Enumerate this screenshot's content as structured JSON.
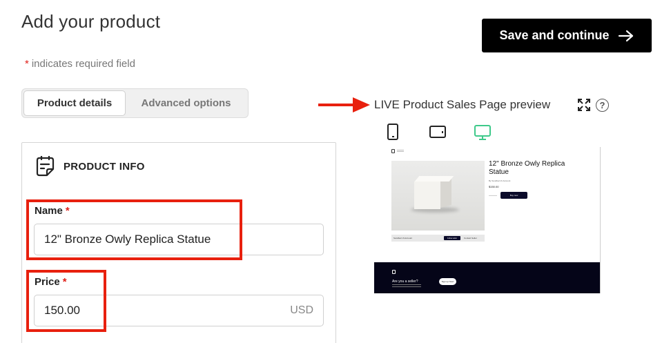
{
  "header": {
    "title": "Add your product",
    "required_star": "*",
    "required_note": "indicates required field",
    "save_label": "Save and continue"
  },
  "tabs": [
    {
      "label": "Product details",
      "active": true
    },
    {
      "label": "Advanced options",
      "active": false
    }
  ],
  "preview": {
    "label": "LIVE Product Sales Page preview",
    "help_glyph": "?",
    "devices": [
      "phone-icon",
      "tablet-icon",
      "desktop-icon"
    ],
    "active_device": "desktop",
    "page": {
      "product_title": "12\" Bronze Owly Replica Statue",
      "by_line": "By Sundbert.th Account",
      "price": "$150.00",
      "buy_label": "Buy now",
      "seller_name": "Sundbert.th Account",
      "follow_label": "Follow seller",
      "contact_label": "Contact Seller",
      "footer_question": "Are you a seller?",
      "signup_label": "Sign up Now!"
    }
  },
  "product_info": {
    "heading": "PRODUCT INFO",
    "name": {
      "label": "Name",
      "required": "*",
      "value": "12\" Bronze Owly Replica Statue"
    },
    "price": {
      "label": "Price",
      "required": "*",
      "value": "150.00",
      "currency": "USD"
    }
  },
  "colors": {
    "accent_black": "#000000",
    "required_red": "#e0201a",
    "annotation_red": "#e8200e",
    "desktop_active": "#3ec98a"
  }
}
